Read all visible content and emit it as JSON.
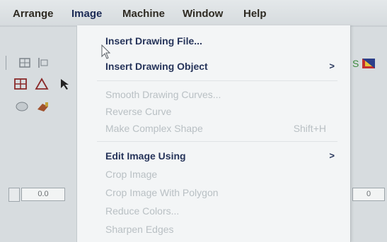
{
  "menubar": {
    "items": [
      "Arrange",
      "Image",
      "Machine",
      "Window",
      "Help"
    ]
  },
  "image_menu": {
    "items": [
      {
        "label": "Insert Drawing File...",
        "enabled": true
      },
      {
        "label": "Insert Drawing Object",
        "enabled": true,
        "submenu": true
      },
      {
        "label": "Smooth Drawing Curves...",
        "enabled": false
      },
      {
        "label": "Reverse Curve",
        "enabled": false
      },
      {
        "label": "Make Complex Shape",
        "enabled": false,
        "shortcut": "Shift+H"
      },
      {
        "label": "Edit Image Using",
        "enabled": true,
        "submenu": true
      },
      {
        "label": "Crop Image",
        "enabled": false
      },
      {
        "label": "Crop Image With Polygon",
        "enabled": false
      },
      {
        "label": "Reduce Colors...",
        "enabled": false
      },
      {
        "label": "Sharpen Edges",
        "enabled": false
      }
    ],
    "submenu_glyph": ">"
  },
  "toolbar": {
    "left_spin_value": "0.0",
    "right_spin_value": "0"
  },
  "colors": {
    "enabled_text": "#26345a",
    "disabled_text": "#b9c0c4",
    "menu_bg": "#f3f5f6"
  }
}
